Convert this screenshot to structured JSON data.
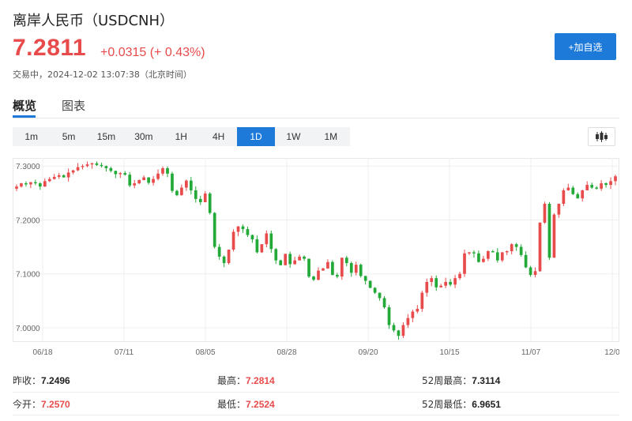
{
  "header": {
    "title": "离岸人民币（USDCNH）",
    "price": "7.2811",
    "change": "+0.0315 (+ 0.43%)",
    "status": "交易中，2024-12-02 13:07:38（北京时间）",
    "add_button": "+加自选"
  },
  "tabs": [
    {
      "label": "概览",
      "active": true
    },
    {
      "label": "图表",
      "active": false
    }
  ],
  "periods": [
    "1m",
    "5m",
    "15m",
    "30m",
    "1H",
    "4H",
    "1D",
    "1W",
    "1M"
  ],
  "active_period": "1D",
  "toggle_icon": "candlestick-icon",
  "colors": {
    "up": "#e84b4b",
    "down": "#22a938",
    "accent": "#1d7ad9"
  },
  "chart_data": {
    "type": "candlestick",
    "y_ticks": [
      "7.3000",
      "7.2000",
      "7.1000",
      "7.0000"
    ],
    "x_ticks": [
      "06/18",
      "07/11",
      "08/05",
      "08/28",
      "09/20",
      "10/15",
      "11/07",
      "12/0"
    ],
    "ylim": [
      6.975,
      7.315
    ],
    "grid": true,
    "close_series": [
      7.262,
      7.268,
      7.266,
      7.27,
      7.268,
      7.262,
      7.272,
      7.276,
      7.28,
      7.283,
      7.279,
      7.288,
      7.292,
      7.298,
      7.3,
      7.303,
      7.305,
      7.302,
      7.3,
      7.296,
      7.291,
      7.285,
      7.287,
      7.284,
      7.264,
      7.268,
      7.274,
      7.279,
      7.269,
      7.276,
      7.286,
      7.296,
      7.286,
      7.254,
      7.246,
      7.26,
      7.273,
      7.255,
      7.239,
      7.233,
      7.249,
      7.213,
      7.15,
      7.132,
      7.12,
      7.145,
      7.178,
      7.188,
      7.183,
      7.172,
      7.164,
      7.14,
      7.155,
      7.175,
      7.146,
      7.125,
      7.116,
      7.137,
      7.118,
      7.125,
      7.132,
      7.128,
      7.095,
      7.089,
      7.106,
      7.11,
      7.122,
      7.098,
      7.095,
      7.13,
      7.12,
      7.102,
      7.117,
      7.096,
      7.087,
      7.074,
      7.065,
      7.055,
      7.038,
      7.005,
      6.995,
      6.985,
      7.005,
      7.018,
      7.03,
      7.035,
      7.065,
      7.085,
      7.092,
      7.075,
      7.078,
      7.085,
      7.08,
      7.092,
      7.1,
      7.138,
      7.14,
      7.138,
      7.122,
      7.128,
      7.142,
      7.14,
      7.125,
      7.14,
      7.142,
      7.155,
      7.15,
      7.135,
      7.112,
      7.098,
      7.105,
      7.195,
      7.23,
      7.13,
      7.21,
      7.23,
      7.255,
      7.26,
      7.248,
      7.24,
      7.255,
      7.265,
      7.26,
      7.258,
      7.268,
      7.265,
      7.272,
      7.281
    ]
  },
  "stats": [
    {
      "label": "昨收：",
      "value": "7.2496",
      "color": "blk"
    },
    {
      "label": "最高：",
      "value": "7.2814",
      "color": "red"
    },
    {
      "label": "52周最高：",
      "value": "7.3114",
      "color": "blk"
    },
    {
      "label": "今开：",
      "value": "7.2570",
      "color": "red"
    },
    {
      "label": "最低：",
      "value": "7.2524",
      "color": "red"
    },
    {
      "label": "52周最低：",
      "value": "6.9651",
      "color": "blk"
    }
  ]
}
